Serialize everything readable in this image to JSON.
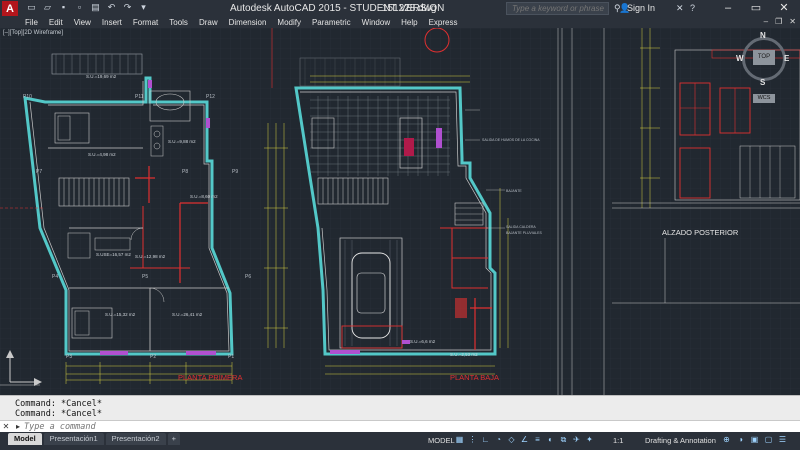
{
  "titlebar": {
    "logo": "A",
    "app_title": "Autodesk AutoCAD 2015 - STUDENT VERSION",
    "file_title": "151228.dwg",
    "search_placeholder": "Type a keyword or phrase",
    "signin_label": "Sign In"
  },
  "menu": {
    "items": [
      "File",
      "Edit",
      "View",
      "Insert",
      "Format",
      "Tools",
      "Draw",
      "Dimension",
      "Modify",
      "Parametric",
      "Window",
      "Help",
      "Express"
    ]
  },
  "viewport": {
    "label": "[–][Top][2D Wireframe]",
    "viewcube": {
      "top": "TOP",
      "n": "N",
      "s": "S",
      "e": "E",
      "w": "W",
      "wcs": "WCS"
    }
  },
  "drawing": {
    "plan1_title": "PLANTA PRIMERA",
    "plan2_title": "PLANTA BAJA",
    "elevation_title": "ALZADO POSTERIOR",
    "room_labels": [
      "S.U.=19,69 m2",
      "S.U.=4,98 m2",
      "S.U.=9,88 m2",
      "S.U.=8,60 m2",
      "S.USE=16,57 m2",
      "S.U.=12,98 m2",
      "S.U.=15,32 m2",
      "S.U.=26,41 m2",
      "S.U.=2,53 m2",
      "S.U.=6,6 m2"
    ],
    "point_labels": [
      "P10",
      "P11",
      "P12",
      "P7",
      "P8",
      "P9",
      "P4",
      "P5",
      "P6",
      "P3",
      "P2",
      "P1"
    ],
    "notes": [
      "SALIDA DE HUMOS DE LA COCINA",
      "BAJANTE",
      "SALIDA CALDERA",
      "BAJANTE PLUVIALES"
    ]
  },
  "command": {
    "history": [
      "Command: *Cancel*",
      "Command: *Cancel*"
    ],
    "placeholder": "Type a command"
  },
  "statusbar": {
    "tabs": [
      "Model",
      "Presentación1",
      "Presentación2",
      "+"
    ],
    "model_label": "MODEL",
    "scale_label": "1:1",
    "workspace_label": "Drafting & Annotation"
  }
}
